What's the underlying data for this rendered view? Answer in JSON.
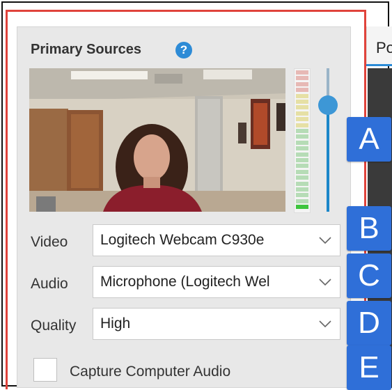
{
  "panel": {
    "title": "Primary Sources",
    "help_icon": "?"
  },
  "right_tab": {
    "label": "Po"
  },
  "fields": {
    "video": {
      "label": "Video",
      "value": "Logitech Webcam C930e"
    },
    "audio": {
      "label": "Audio",
      "value": "Microphone (Logitech Wel"
    },
    "quality": {
      "label": "Quality",
      "value": "High"
    }
  },
  "checkbox": {
    "label": "Capture Computer Audio",
    "checked": false
  },
  "annotations": [
    "A",
    "B",
    "C",
    "D",
    "E"
  ],
  "colors": {
    "accent": "#2d8bd6",
    "badge": "#2f6fd8",
    "highlight_frame": "#e0433b",
    "meter_active": "#3ec53e"
  },
  "icons": {
    "help": "help-circle-icon",
    "dropdown": "chevron-down-icon"
  },
  "audio_level": 0.05
}
